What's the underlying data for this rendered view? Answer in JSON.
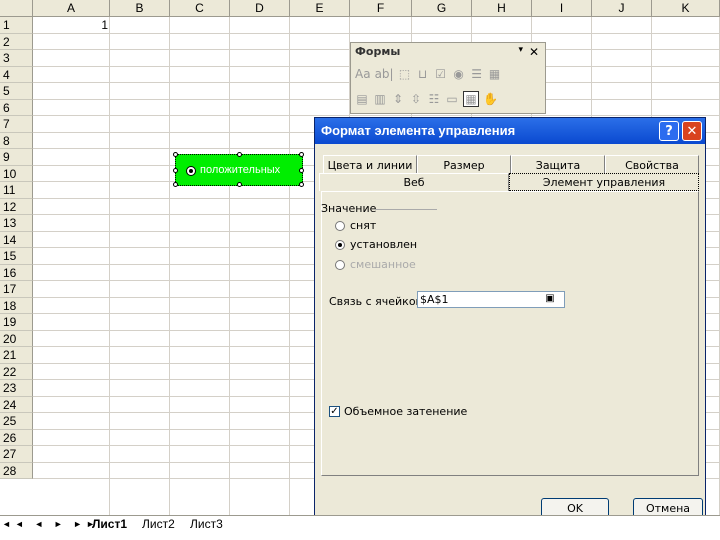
{
  "sheet": {
    "columns": [
      "A",
      "B",
      "C",
      "D",
      "E",
      "F",
      "G",
      "H",
      "I",
      "J",
      "K"
    ],
    "rows": [
      "1",
      "2",
      "3",
      "4",
      "5",
      "6",
      "7",
      "8",
      "9",
      "10",
      "11",
      "12",
      "13",
      "14",
      "15",
      "16",
      "17",
      "18",
      "19",
      "20",
      "21",
      "22",
      "23",
      "24",
      "25",
      "26",
      "27",
      "28"
    ],
    "cell_a1": "1"
  },
  "radio_control": {
    "label": "положительных"
  },
  "forms_toolbar": {
    "title": "Формы",
    "menu_icon": "▾",
    "close_icon": "✕",
    "row1": [
      "Aa",
      "ab|",
      "⬚",
      "⊔",
      "☑",
      "◉",
      "☰",
      "▦"
    ],
    "row2": [
      "▤",
      "▥",
      "⇕",
      "⇳",
      "☷",
      "▭",
      "▦",
      "✋"
    ]
  },
  "dialog": {
    "title": "Формат элемента управления",
    "help": "?",
    "close": "✕",
    "tabs_row1": [
      "Цвета и линии",
      "Размер",
      "Защита",
      "Свойства"
    ],
    "tabs_row2": [
      "Веб",
      "Элемент управления"
    ],
    "group_label": "Значение",
    "options": [
      {
        "label": "снят",
        "checked": false,
        "disabled": false
      },
      {
        "label": "установлен",
        "checked": true,
        "disabled": false
      },
      {
        "label": "смешанное",
        "checked": false,
        "disabled": true
      }
    ],
    "link_label": "Связь с ячейкой:",
    "link_value": "$A$1",
    "link_button": "▣",
    "shading_label": "Объемное затенение",
    "shading_check": "✓",
    "ok": "OK",
    "cancel": "Отмена"
  },
  "sheet_tabs": {
    "nav": "◄◄ ◄ ► ►►",
    "tabs": [
      "Лист1",
      "Лист2",
      "Лист3"
    ]
  }
}
